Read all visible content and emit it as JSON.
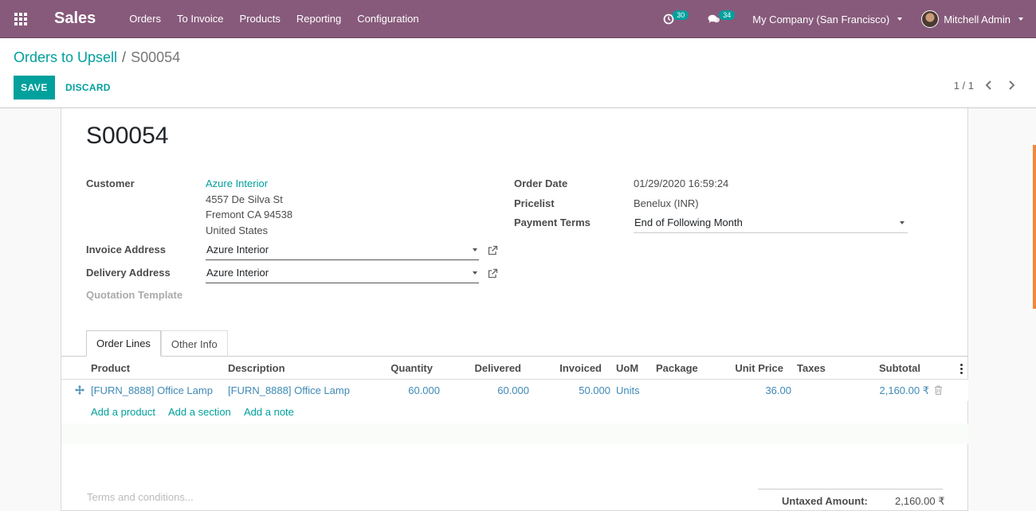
{
  "navbar": {
    "app_name": "Sales",
    "menu": [
      "Orders",
      "To Invoice",
      "Products",
      "Reporting",
      "Configuration"
    ],
    "activity_count": "30",
    "message_count": "34",
    "company": "My Company (San Francisco)",
    "user": "Mitchell Admin"
  },
  "control_panel": {
    "breadcrumb_parent": "Orders to Upsell",
    "breadcrumb_sep": "/",
    "breadcrumb_current": "S00054",
    "save_label": "SAVE",
    "discard_label": "DISCARD",
    "pager": "1 / 1"
  },
  "form": {
    "name": "S00054",
    "customer_label": "Customer",
    "customer_name": "Azure Interior",
    "customer_address_1": "4557 De Silva St",
    "customer_address_2": "Fremont CA 94538",
    "customer_address_3": "United States",
    "invoice_address_label": "Invoice Address",
    "invoice_address_value": "Azure Interior",
    "delivery_address_label": "Delivery Address",
    "delivery_address_value": "Azure Interior",
    "quotation_template_label": "Quotation Template",
    "order_date_label": "Order Date",
    "order_date_value": "01/29/2020 16:59:24",
    "pricelist_label": "Pricelist",
    "pricelist_value": "Benelux (INR)",
    "payment_terms_label": "Payment Terms",
    "payment_terms_value": "End of Following Month"
  },
  "tabs": [
    "Order Lines",
    "Other Info"
  ],
  "table": {
    "headers": {
      "product": "Product",
      "description": "Description",
      "quantity": "Quantity",
      "delivered": "Delivered",
      "invoiced": "Invoiced",
      "uom": "UoM",
      "package": "Package",
      "unit_price": "Unit Price",
      "taxes": "Taxes",
      "subtotal": "Subtotal"
    },
    "rows": [
      {
        "product": "[FURN_8888] Office Lamp",
        "description": "[FURN_8888] Office Lamp",
        "quantity": "60.000",
        "delivered": "60.000",
        "invoiced": "50.000",
        "uom": "Units",
        "package": "",
        "unit_price": "36.00",
        "taxes": "",
        "subtotal": "2,160.00 ₹"
      }
    ],
    "add_product": "Add a product",
    "add_section": "Add a section",
    "add_note": "Add a note"
  },
  "footer": {
    "terms_placeholder": "Terms and conditions...",
    "untaxed_label": "Untaxed Amount:",
    "untaxed_value": "2,160.00 ₹"
  },
  "colors": {
    "navbar": "#875a7b",
    "accent": "#00a09d",
    "link_blue": "#3e8ab5"
  }
}
